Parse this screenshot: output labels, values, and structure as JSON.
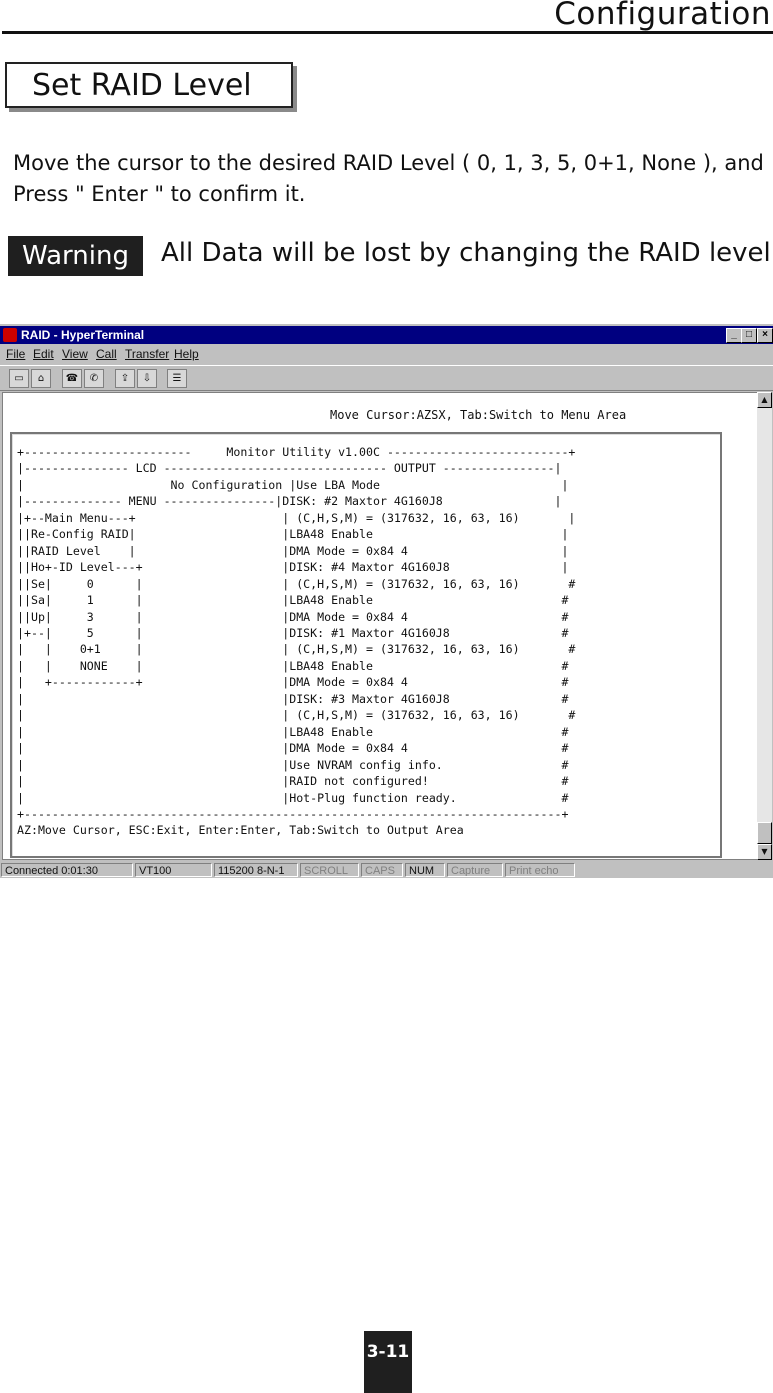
{
  "page": {
    "heading": "Configuration",
    "section_title": "Set RAID Level",
    "instruction": "Move the cursor to the desired RAID Level ( 0, 1, 3, 5, 0+1, None ), and Press \" Enter \" to confirm it.",
    "warning_label": "Warning",
    "warning_text": "All Data will be lost by changing the RAID level.",
    "page_number": "3-11"
  },
  "window": {
    "title": "RAID - HyperTerminal",
    "controls": [
      "_",
      "□",
      "×"
    ],
    "menus": [
      "File",
      "Edit",
      "View",
      "Call",
      "Transfer",
      "Help"
    ],
    "toolbar_icons": [
      "new-icon",
      "open-icon",
      "phone-icon",
      "disconnect-icon",
      "send-icon",
      "receive-icon",
      "properties-icon"
    ]
  },
  "terminal": {
    "cursor_hint": "Move Cursor:AZSX, Tab:Switch to Menu Area",
    "lines": [
      "+------------------------     Monitor Utility v1.00C --------------------------+",
      "|--------------- LCD -------------------------------- OUTPUT ----------------|",
      "|                     No Configuration |Use LBA Mode                          |",
      "|-------------- MENU ----------------|DISK: #2 Maxtor 4G160J8                |",
      "|+--Main Menu---+                     | (C,H,S,M) = (317632, 16, 63, 16)       |",
      "||Re-Config RAID|                     |LBA48 Enable                           |",
      "||RAID Level    |                     |DMA Mode = 0x84 4                      |",
      "||Ho+-ID Level---+                    |DISK: #4 Maxtor 4G160J8                |",
      "||Se|     0      |                    | (C,H,S,M) = (317632, 16, 63, 16)       #",
      "||Sa|     1      |                    |LBA48 Enable                           #",
      "||Up|     3      |                    |DMA Mode = 0x84 4                      #",
      "|+--|     5      |                    |DISK: #1 Maxtor 4G160J8                #",
      "|   |    0+1     |                    | (C,H,S,M) = (317632, 16, 63, 16)       #",
      "|   |    NONE    |                    |LBA48 Enable                           #",
      "|   +------------+                    |DMA Mode = 0x84 4                      #",
      "|                                     |DISK: #3 Maxtor 4G160J8                #",
      "|                                     | (C,H,S,M) = (317632, 16, 63, 16)       #",
      "|                                     |LBA48 Enable                           #",
      "|                                     |DMA Mode = 0x84 4                      #",
      "|                                     |Use NVRAM config info.                 #",
      "|                                     |RAID not configured!                   #",
      "|                                     |Hot-Plug function ready.               #",
      "+-----------------------------------------------------------------------------+",
      "AZ:Move Cursor, ESC:Exit, Enter:Enter, Tab:Switch to Output Area"
    ]
  },
  "status_bar": {
    "items": [
      "Connected 0:01:30",
      "VT100",
      "115200 8-N-1",
      "SCROLL",
      "CAPS",
      "NUM",
      "Capture",
      "Print echo"
    ]
  }
}
